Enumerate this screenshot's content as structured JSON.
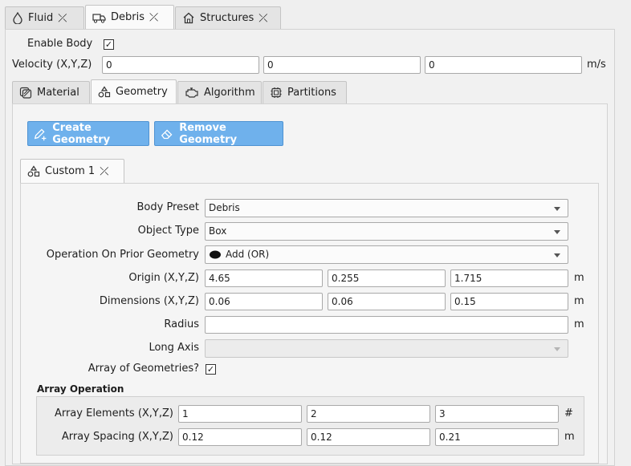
{
  "top_tabs": [
    {
      "label": "Fluid",
      "icon": "drop-icon"
    },
    {
      "label": "Debris",
      "icon": "truck-icon"
    },
    {
      "label": "Structures",
      "icon": "home-icon"
    }
  ],
  "close_glyph": "⤫",
  "enable_body": {
    "label": "Enable Body",
    "checked": "✓"
  },
  "velocity": {
    "label": "Velocity (X,Y,Z)",
    "x": "0",
    "y": "0",
    "z": "0",
    "unit": "m/s"
  },
  "sub_tabs": [
    {
      "label": "Material",
      "icon": "layers-icon"
    },
    {
      "label": "Geometry",
      "icon": "shapes-icon"
    },
    {
      "label": "Algorithm",
      "icon": "engine-icon"
    },
    {
      "label": "Partitions",
      "icon": "chip-icon"
    }
  ],
  "buttons": {
    "create": "Create Geometry",
    "remove": "Remove Geometry"
  },
  "geometry_tab": {
    "label": "Custom 1"
  },
  "form": {
    "body_preset": {
      "label": "Body Preset",
      "value": "Debris"
    },
    "object_type": {
      "label": "Object Type",
      "value": "Box"
    },
    "operation": {
      "label": "Operation On Prior Geometry",
      "value": "Add (OR)"
    },
    "origin": {
      "label": "Origin (X,Y,Z)",
      "x": "4.65",
      "y": "0.255",
      "z": "1.715",
      "unit": "m"
    },
    "dimensions": {
      "label": "Dimensions (X,Y,Z)",
      "x": "0.06",
      "y": "0.06",
      "z": "0.15",
      "unit": "m"
    },
    "radius": {
      "label": "Radius",
      "value": "",
      "unit": "m"
    },
    "long_axis": {
      "label": "Long Axis",
      "value": ""
    },
    "array_geometries": {
      "label": "Array of Geometries?",
      "checked": "✓"
    }
  },
  "array_operation": {
    "title": "Array Operation",
    "elements": {
      "label": "Array Elements (X,Y,Z)",
      "x": "1",
      "y": "2",
      "z": "3",
      "unit": "#"
    },
    "spacing": {
      "label": "Array Spacing (X,Y,Z)",
      "x": "0.12",
      "y": "0.12",
      "z": "0.21",
      "unit": "m"
    }
  }
}
